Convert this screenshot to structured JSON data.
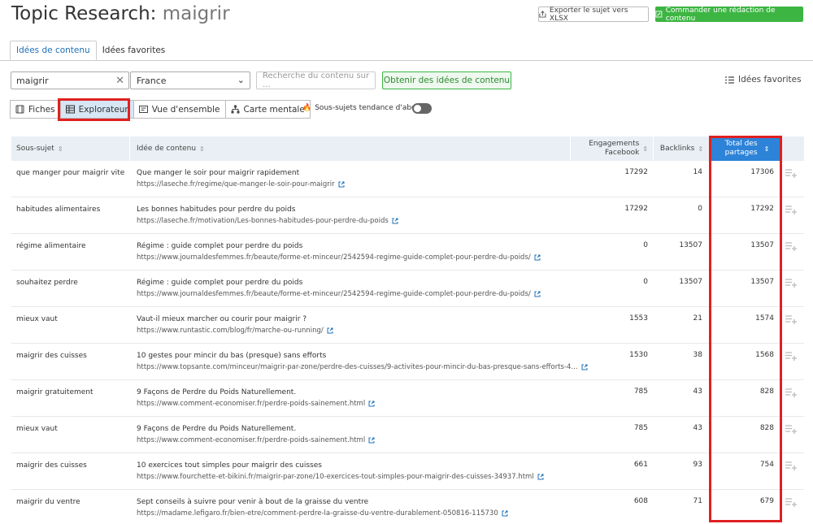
{
  "header": {
    "title": "Topic Research:",
    "keyword": "maigrir",
    "export_label": "Exporter le sujet vers XLSX",
    "order_label": "Commander une rédaction de contenu"
  },
  "tabs": [
    {
      "label": "Idées de contenu",
      "active": true
    },
    {
      "label": "Idées favorites",
      "active": false
    }
  ],
  "search": {
    "keyword_value": "maigrir",
    "country_value": "France",
    "content_placeholder": "Recherche du contenu sur ...",
    "get_ideas_label": "Obtenir des idées de contenu",
    "favorites_label": "Idées favorites"
  },
  "views": [
    {
      "label": "Fiches",
      "icon": "cards-icon",
      "active": false
    },
    {
      "label": "Explorateur",
      "icon": "table-icon",
      "active": true
    },
    {
      "label": "Vue d'ensemble",
      "icon": "overview-icon",
      "active": false
    },
    {
      "label": "Carte mentale",
      "icon": "mindmap-icon",
      "active": false
    }
  ],
  "trend_label": "Sous-sujets tendance d'abord",
  "table": {
    "columns": {
      "subtopic": "Sous-sujet",
      "idea": "Idée de contenu",
      "facebook": "Engagements Facebook",
      "backlinks": "Backlinks",
      "total": "Total des partages"
    },
    "rows": [
      {
        "subtopic": "que manger pour maigrir vite",
        "title": "Que manger le soir pour maigrir rapidement",
        "url": "https://laseche.fr/regime/que-manger-le-soir-pour-maigrir",
        "facebook": "17292",
        "backlinks": "14",
        "total": "17306"
      },
      {
        "subtopic": "habitudes alimentaires",
        "title": "Les bonnes habitudes pour perdre du poids",
        "url": "https://laseche.fr/motivation/Les-bonnes-habitudes-pour-perdre-du-poids",
        "facebook": "17292",
        "backlinks": "0",
        "total": "17292"
      },
      {
        "subtopic": "régime alimentaire",
        "title": "Régime : guide complet pour perdre du poids",
        "url": "https://www.journaldesfemmes.fr/beaute/forme-et-minceur/2542594-regime-guide-complet-pour-perdre-du-poids/",
        "facebook": "0",
        "backlinks": "13507",
        "total": "13507"
      },
      {
        "subtopic": "souhaitez perdre",
        "title": "Régime : guide complet pour perdre du poids",
        "url": "https://www.journaldesfemmes.fr/beaute/forme-et-minceur/2542594-regime-guide-complet-pour-perdre-du-poids/",
        "facebook": "0",
        "backlinks": "13507",
        "total": "13507"
      },
      {
        "subtopic": "mieux vaut",
        "title": "Vaut-il mieux marcher ou courir pour maigrir ?",
        "url": "https://www.runtastic.com/blog/fr/marche-ou-running/",
        "facebook": "1553",
        "backlinks": "21",
        "total": "1574"
      },
      {
        "subtopic": "maigrir des cuisses",
        "title": "10 gestes pour mincir du bas (presque) sans efforts",
        "url": "https://www.topsante.com/minceur/maigrir-par-zone/perdre-des-cuisses/9-activites-pour-mincir-du-bas-presque-sans-efforts-4...",
        "facebook": "1530",
        "backlinks": "38",
        "total": "1568"
      },
      {
        "subtopic": "maigrir gratuitement",
        "title": "9 Façons de Perdre du Poids Naturellement.",
        "url": "https://www.comment-economiser.fr/perdre-poids-sainement.html",
        "facebook": "785",
        "backlinks": "43",
        "total": "828"
      },
      {
        "subtopic": "mieux vaut",
        "title": "9 Façons de Perdre du Poids Naturellement.",
        "url": "https://www.comment-economiser.fr/perdre-poids-sainement.html",
        "facebook": "785",
        "backlinks": "43",
        "total": "828"
      },
      {
        "subtopic": "maigrir des cuisses",
        "title": "10 exercices tout simples pour maigrir des cuisses",
        "url": "https://www.fourchette-et-bikini.fr/maigrir-par-zone/10-exercices-tout-simples-pour-maigrir-des-cuisses-34937.html",
        "facebook": "661",
        "backlinks": "93",
        "total": "754"
      },
      {
        "subtopic": "maigrir du ventre",
        "title": "Sept conseils à suivre pour venir à bout de la graisse du ventre",
        "url": "https://madame.lefigaro.fr/bien-etre/comment-perdre-la-graisse-du-ventre-durablement-050816-115730",
        "facebook": "608",
        "backlinks": "71",
        "total": "679"
      }
    ]
  },
  "colors": {
    "accent_blue": "#2d83d8",
    "green": "#3db543",
    "highlight_red": "#e02020"
  }
}
